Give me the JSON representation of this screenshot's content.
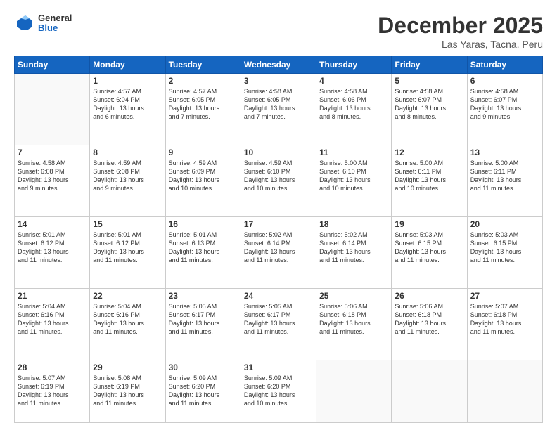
{
  "logo": {
    "general": "General",
    "blue": "Blue"
  },
  "header": {
    "month": "December 2025",
    "location": "Las Yaras, Tacna, Peru"
  },
  "weekdays": [
    "Sunday",
    "Monday",
    "Tuesday",
    "Wednesday",
    "Thursday",
    "Friday",
    "Saturday"
  ],
  "weeks": [
    [
      {
        "day": "",
        "text": ""
      },
      {
        "day": "1",
        "text": "Sunrise: 4:57 AM\nSunset: 6:04 PM\nDaylight: 13 hours\nand 6 minutes."
      },
      {
        "day": "2",
        "text": "Sunrise: 4:57 AM\nSunset: 6:05 PM\nDaylight: 13 hours\nand 7 minutes."
      },
      {
        "day": "3",
        "text": "Sunrise: 4:58 AM\nSunset: 6:05 PM\nDaylight: 13 hours\nand 7 minutes."
      },
      {
        "day": "4",
        "text": "Sunrise: 4:58 AM\nSunset: 6:06 PM\nDaylight: 13 hours\nand 8 minutes."
      },
      {
        "day": "5",
        "text": "Sunrise: 4:58 AM\nSunset: 6:07 PM\nDaylight: 13 hours\nand 8 minutes."
      },
      {
        "day": "6",
        "text": "Sunrise: 4:58 AM\nSunset: 6:07 PM\nDaylight: 13 hours\nand 9 minutes."
      }
    ],
    [
      {
        "day": "7",
        "text": "Sunrise: 4:58 AM\nSunset: 6:08 PM\nDaylight: 13 hours\nand 9 minutes."
      },
      {
        "day": "8",
        "text": "Sunrise: 4:59 AM\nSunset: 6:08 PM\nDaylight: 13 hours\nand 9 minutes."
      },
      {
        "day": "9",
        "text": "Sunrise: 4:59 AM\nSunset: 6:09 PM\nDaylight: 13 hours\nand 10 minutes."
      },
      {
        "day": "10",
        "text": "Sunrise: 4:59 AM\nSunset: 6:10 PM\nDaylight: 13 hours\nand 10 minutes."
      },
      {
        "day": "11",
        "text": "Sunrise: 5:00 AM\nSunset: 6:10 PM\nDaylight: 13 hours\nand 10 minutes."
      },
      {
        "day": "12",
        "text": "Sunrise: 5:00 AM\nSunset: 6:11 PM\nDaylight: 13 hours\nand 10 minutes."
      },
      {
        "day": "13",
        "text": "Sunrise: 5:00 AM\nSunset: 6:11 PM\nDaylight: 13 hours\nand 11 minutes."
      }
    ],
    [
      {
        "day": "14",
        "text": "Sunrise: 5:01 AM\nSunset: 6:12 PM\nDaylight: 13 hours\nand 11 minutes."
      },
      {
        "day": "15",
        "text": "Sunrise: 5:01 AM\nSunset: 6:12 PM\nDaylight: 13 hours\nand 11 minutes."
      },
      {
        "day": "16",
        "text": "Sunrise: 5:01 AM\nSunset: 6:13 PM\nDaylight: 13 hours\nand 11 minutes."
      },
      {
        "day": "17",
        "text": "Sunrise: 5:02 AM\nSunset: 6:14 PM\nDaylight: 13 hours\nand 11 minutes."
      },
      {
        "day": "18",
        "text": "Sunrise: 5:02 AM\nSunset: 6:14 PM\nDaylight: 13 hours\nand 11 minutes."
      },
      {
        "day": "19",
        "text": "Sunrise: 5:03 AM\nSunset: 6:15 PM\nDaylight: 13 hours\nand 11 minutes."
      },
      {
        "day": "20",
        "text": "Sunrise: 5:03 AM\nSunset: 6:15 PM\nDaylight: 13 hours\nand 11 minutes."
      }
    ],
    [
      {
        "day": "21",
        "text": "Sunrise: 5:04 AM\nSunset: 6:16 PM\nDaylight: 13 hours\nand 11 minutes."
      },
      {
        "day": "22",
        "text": "Sunrise: 5:04 AM\nSunset: 6:16 PM\nDaylight: 13 hours\nand 11 minutes."
      },
      {
        "day": "23",
        "text": "Sunrise: 5:05 AM\nSunset: 6:17 PM\nDaylight: 13 hours\nand 11 minutes."
      },
      {
        "day": "24",
        "text": "Sunrise: 5:05 AM\nSunset: 6:17 PM\nDaylight: 13 hours\nand 11 minutes."
      },
      {
        "day": "25",
        "text": "Sunrise: 5:06 AM\nSunset: 6:18 PM\nDaylight: 13 hours\nand 11 minutes."
      },
      {
        "day": "26",
        "text": "Sunrise: 5:06 AM\nSunset: 6:18 PM\nDaylight: 13 hours\nand 11 minutes."
      },
      {
        "day": "27",
        "text": "Sunrise: 5:07 AM\nSunset: 6:18 PM\nDaylight: 13 hours\nand 11 minutes."
      }
    ],
    [
      {
        "day": "28",
        "text": "Sunrise: 5:07 AM\nSunset: 6:19 PM\nDaylight: 13 hours\nand 11 minutes."
      },
      {
        "day": "29",
        "text": "Sunrise: 5:08 AM\nSunset: 6:19 PM\nDaylight: 13 hours\nand 11 minutes."
      },
      {
        "day": "30",
        "text": "Sunrise: 5:09 AM\nSunset: 6:20 PM\nDaylight: 13 hours\nand 11 minutes."
      },
      {
        "day": "31",
        "text": "Sunrise: 5:09 AM\nSunset: 6:20 PM\nDaylight: 13 hours\nand 10 minutes."
      },
      {
        "day": "",
        "text": ""
      },
      {
        "day": "",
        "text": ""
      },
      {
        "day": "",
        "text": ""
      }
    ]
  ]
}
